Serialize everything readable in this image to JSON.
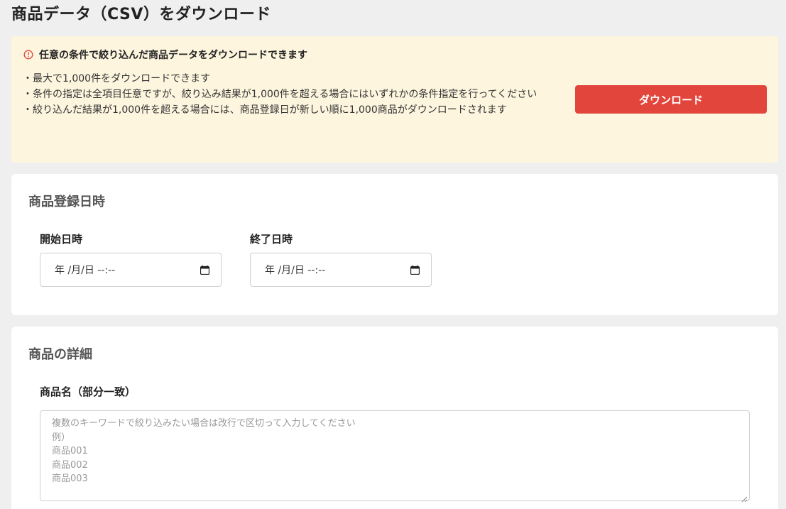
{
  "page": {
    "title": "商品データ（CSV）をダウンロード"
  },
  "notice": {
    "heading": "任意の条件で絞り込んだ商品データをダウンロードできます",
    "items": [
      "最大で1,000件をダウンロードできます",
      "条件の指定は全項目任意ですが、絞り込み結果が1,000件を超える場合にはいずれかの条件指定を行ってください",
      "絞り込んだ結果が1,000件を超える場合には、商品登録日が新しい順に1,000商品がダウンロードされます"
    ],
    "download_label": "ダウンロード",
    "accent_color": "#e2453c",
    "background_color": "#fdf5de",
    "icon": "info-circle-icon"
  },
  "registration": {
    "title": "商品登録日時",
    "start_label": "開始日時",
    "start_value": "年 /月/日 --:--",
    "end_label": "終了日時",
    "end_value": "年 /月/日 --:--",
    "icon": "calendar-icon"
  },
  "details": {
    "title": "商品の詳細",
    "name_label": "商品名（部分一致）",
    "name_placeholder_lines": [
      "複数のキーワードで絞り込みたい場合は改行で区切って入力してください",
      "例）",
      "商品001",
      "商品002",
      "商品003"
    ]
  }
}
